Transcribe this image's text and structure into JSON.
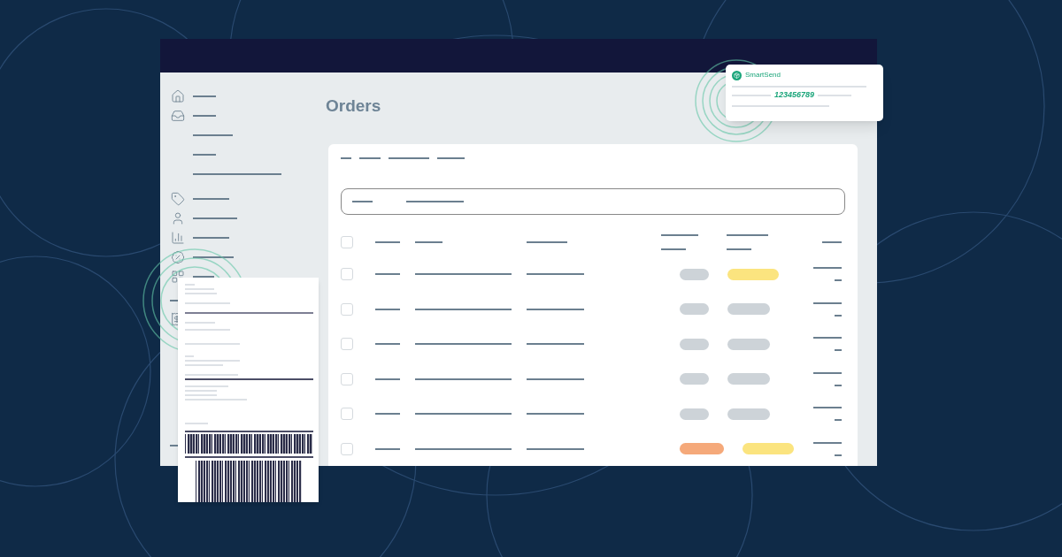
{
  "page": {
    "title": "Orders"
  },
  "notification": {
    "brand": "SmartSend",
    "tracking_number": "123456789"
  },
  "orders_table": {
    "select_all_checked": false,
    "rows": [
      {
        "checked": false,
        "pills": [
          {
            "color": "#cdd3d8",
            "wide": false
          },
          {
            "color": "#fbe47f",
            "wide": true
          }
        ]
      },
      {
        "checked": false,
        "pills": [
          {
            "color": "#cdd3d8",
            "wide": false
          },
          {
            "color": "#cdd3d8",
            "wide": false
          }
        ]
      },
      {
        "checked": false,
        "pills": [
          {
            "color": "#cdd3d8",
            "wide": false
          },
          {
            "color": "#cdd3d8",
            "wide": false
          }
        ]
      },
      {
        "checked": false,
        "pills": [
          {
            "color": "#cdd3d8",
            "wide": false
          },
          {
            "color": "#cdd3d8",
            "wide": false
          }
        ]
      },
      {
        "checked": false,
        "pills": [
          {
            "color": "#cdd3d8",
            "wide": false
          },
          {
            "color": "#cdd3d8",
            "wide": false
          }
        ]
      },
      {
        "checked": false,
        "pills": [
          {
            "color": "#f5a97a",
            "wide": true
          },
          {
            "color": "#fbe47f",
            "wide": true
          }
        ]
      }
    ]
  }
}
